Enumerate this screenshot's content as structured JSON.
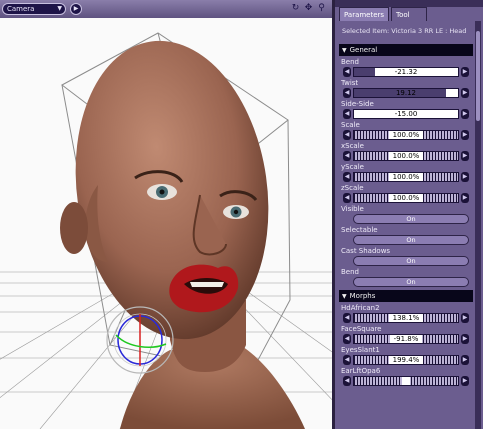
{
  "viewport": {
    "camera_label": "Camera",
    "tools": [
      "rotate-icon",
      "move-icon",
      "zoom-icon"
    ]
  },
  "panel": {
    "tabs": [
      "Parameters",
      "Tool"
    ],
    "selected_item": "Selected Item:  Victoria 3 RR LE : Head",
    "sections": [
      {
        "title": "General",
        "params": [
          {
            "label": "Bend",
            "kind": "dial",
            "value": "-21.32",
            "level": 0.2
          },
          {
            "label": "Twist",
            "kind": "dial",
            "value": "19.12",
            "level": 0.88
          },
          {
            "label": "Side-Side",
            "kind": "dial",
            "value": "-15.00",
            "level": 0
          },
          {
            "label": "Scale",
            "kind": "ruler",
            "value": "100.0%"
          },
          {
            "label": "xScale",
            "kind": "ruler",
            "value": "100.0%"
          },
          {
            "label": "yScale",
            "kind": "ruler",
            "value": "100.0%"
          },
          {
            "label": "zScale",
            "kind": "ruler",
            "value": "100.0%"
          },
          {
            "label": "Visible",
            "kind": "toggle",
            "value": "On"
          },
          {
            "label": "Selectable",
            "kind": "toggle",
            "value": "On"
          },
          {
            "label": "Cast Shadows",
            "kind": "toggle",
            "value": "On"
          },
          {
            "label": "Bend",
            "kind": "toggle",
            "value": "On"
          }
        ]
      },
      {
        "title": "Morphs",
        "params": [
          {
            "label": "HdAfrican2",
            "kind": "ruler",
            "value": "138.1%"
          },
          {
            "label": "FaceSquare",
            "kind": "ruler",
            "value": "-91.8%"
          },
          {
            "label": "EyesSlant1",
            "kind": "ruler",
            "value": "199.4%"
          },
          {
            "label": "EarLftOpa6",
            "kind": "ruler",
            "value": ""
          }
        ]
      }
    ]
  },
  "colors": {
    "panel": "#6b5d8f",
    "section": "#08061a",
    "accent": "#8b7db2"
  }
}
